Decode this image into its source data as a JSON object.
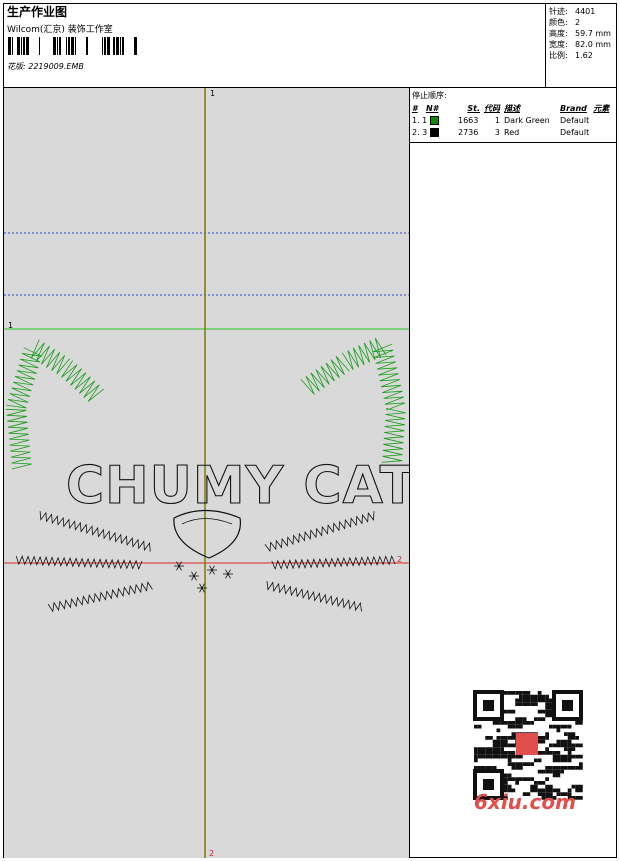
{
  "header": {
    "title": "生产作业图",
    "software": "Wilcom(汇京) 装饰工作室",
    "design_file": "花版: 2219009.EMB"
  },
  "stats": [
    {
      "key": "针迹:",
      "value": "4401"
    },
    {
      "key": "颜色:",
      "value": "2"
    },
    {
      "key": "高度:",
      "value": "59.7 mm"
    },
    {
      "key": "宽度:",
      "value": "82.0 mm"
    },
    {
      "key": "比例:",
      "value": "1.62"
    }
  ],
  "stop_sequence": {
    "title": "停止顺序:",
    "headers": [
      "#",
      "N#",
      "St.",
      "代码",
      "描述",
      "Brand",
      "元素"
    ],
    "rows": [
      {
        "num": "1. 1",
        "stitches": "1663",
        "code": "1",
        "desc": "Dark Green",
        "brand": "Default",
        "color": "#0a8a0a"
      },
      {
        "num": "2. 3",
        "stitches": "2736",
        "code": "3",
        "desc": "Red",
        "brand": "Default",
        "color": "#000000"
      }
    ]
  },
  "canvas": {
    "design_text": "CHUMY CAT",
    "axis_labels": {
      "top": "1",
      "left": "1",
      "right": "2",
      "bottom": "2"
    }
  },
  "watermark": {
    "text": "6xiu.com"
  },
  "colors": {
    "canvas_bg": "#d9d9d9",
    "green": "#1a9e1a",
    "axis": "#7a7a00",
    "blue_guide": "#3344cc",
    "red_guide": "#dd2222"
  }
}
